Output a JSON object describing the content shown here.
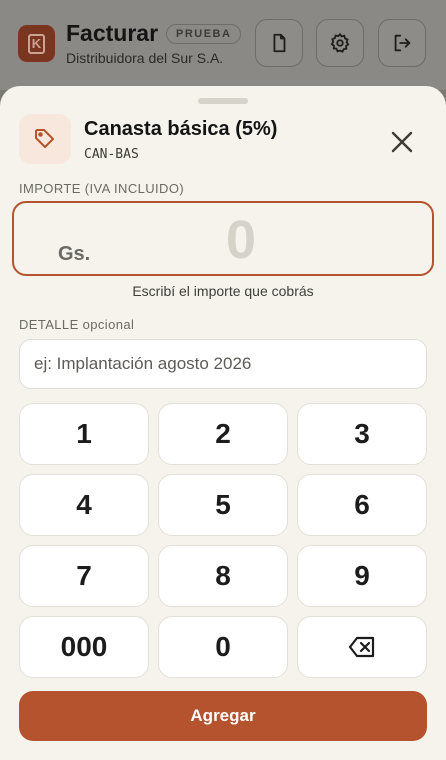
{
  "header": {
    "brand": "Facturar",
    "badge": "PRUEBA",
    "company": "Distribuidora del Sur S.A.",
    "logo_letter": "K"
  },
  "sheet": {
    "category_title": "Canasta básica (5%)",
    "category_code": "CAN-BAS",
    "amount_label": "IMPORTE (IVA INCLUIDO)",
    "currency": "Gs.",
    "amount_value": "0",
    "hint": "Escribí el importe que cobrás",
    "detail_label": "DETALLE opcional",
    "detail_placeholder": "ej: Implantación agosto 2026",
    "keys": [
      "1",
      "2",
      "3",
      "4",
      "5",
      "6",
      "7",
      "8",
      "9",
      "000",
      "0"
    ],
    "add_label": "Agregar"
  },
  "colors": {
    "accent": "#b5532f",
    "sheet_bg": "#f5f3ec"
  }
}
